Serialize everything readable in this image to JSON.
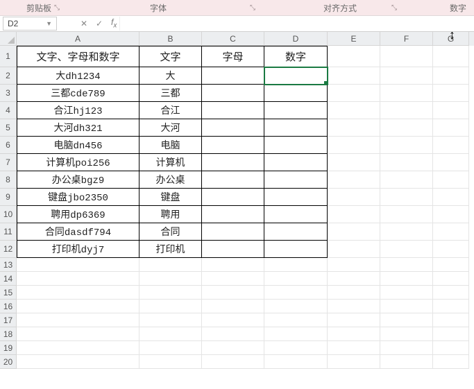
{
  "ribbon": {
    "group1": "剪贴板",
    "group2": "字体",
    "group3": "对齐方式",
    "group4": "数字"
  },
  "namebox": {
    "value": "D2"
  },
  "formula": {
    "value": ""
  },
  "columns": [
    "A",
    "B",
    "C",
    "D",
    "E",
    "F",
    "G"
  ],
  "row_count_data": 12,
  "row_count_empty_visible": 8,
  "headers": {
    "A": "文字、字母和数字",
    "B": "文字",
    "C": "字母",
    "D": "数字"
  },
  "rows": [
    {
      "A": "大dh1234",
      "B": "大",
      "C": "",
      "D": ""
    },
    {
      "A": "三都cde789",
      "B": "三都",
      "C": "",
      "D": ""
    },
    {
      "A": "合江hj123",
      "B": "合江",
      "C": "",
      "D": ""
    },
    {
      "A": "大河dh321",
      "B": "大河",
      "C": "",
      "D": ""
    },
    {
      "A": "电脑dn456",
      "B": "电脑",
      "C": "",
      "D": ""
    },
    {
      "A": "计算机poi256",
      "B": "计算机",
      "C": "",
      "D": ""
    },
    {
      "A": "办公桌bgz9",
      "B": "办公桌",
      "C": "",
      "D": ""
    },
    {
      "A": "键盘jbo2350",
      "B": "键盘",
      "C": "",
      "D": ""
    },
    {
      "A": "聘用dp6369",
      "B": "聘用",
      "C": "",
      "D": ""
    },
    {
      "A": "合同dasdf794",
      "B": "合同",
      "C": "",
      "D": ""
    },
    {
      "A": "打印机dyj7",
      "B": "打印机",
      "C": "",
      "D": ""
    }
  ],
  "selected_cell": "D2",
  "chart_data": {
    "type": "table",
    "title": "",
    "columns": [
      "文字、字母和数字",
      "文字",
      "字母",
      "数字"
    ],
    "rows": [
      [
        "大dh1234",
        "大",
        "",
        ""
      ],
      [
        "三都cde789",
        "三都",
        "",
        ""
      ],
      [
        "合江hj123",
        "合江",
        "",
        ""
      ],
      [
        "大河dh321",
        "大河",
        "",
        ""
      ],
      [
        "电脑dn456",
        "电脑",
        "",
        ""
      ],
      [
        "计算机poi256",
        "计算机",
        "",
        ""
      ],
      [
        "办公桌bgz9",
        "办公桌",
        "",
        ""
      ],
      [
        "键盘jbo2350",
        "键盘",
        "",
        ""
      ],
      [
        "聘用dp6369",
        "聘用",
        "",
        ""
      ],
      [
        "合同dasdf794",
        "合同",
        "",
        ""
      ],
      [
        "打印机dyj7",
        "打印机",
        "",
        ""
      ]
    ]
  }
}
